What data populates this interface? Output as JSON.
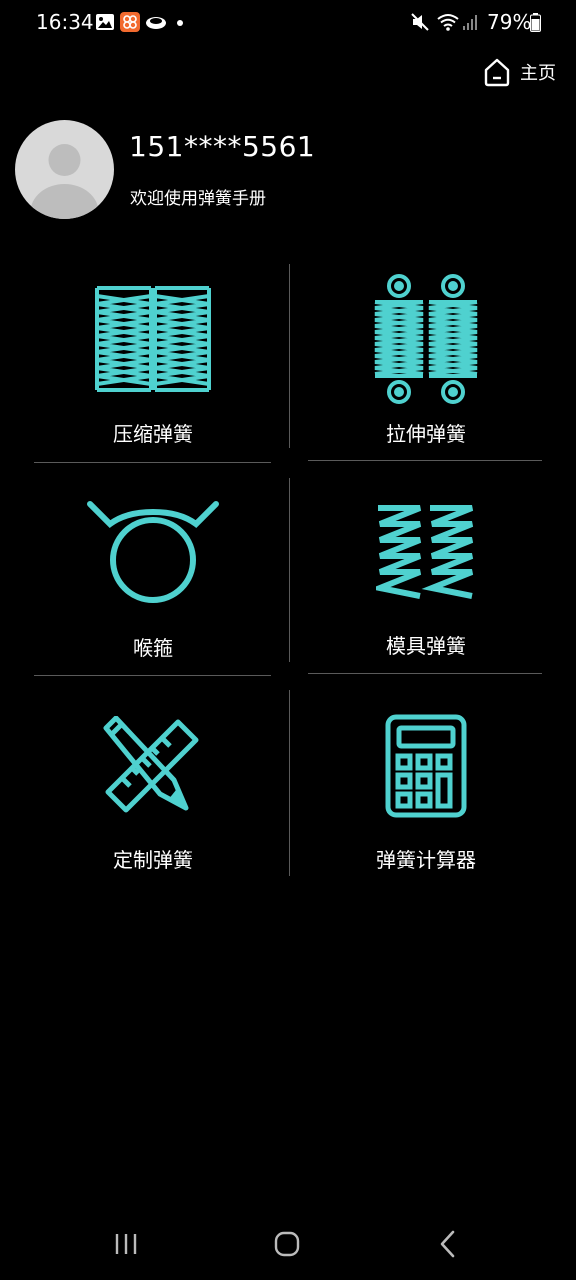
{
  "status_bar": {
    "time": "16:34",
    "battery": "79%",
    "icons": [
      "gallery-icon",
      "app-icon",
      "cloud-icon",
      "mute-icon",
      "wifi-icon",
      "signal-icon",
      "battery-icon"
    ]
  },
  "header": {
    "home_label": "主页",
    "home_icon": "home-icon"
  },
  "profile": {
    "phone": "151****5561",
    "welcome": "欢迎使用弹簧手册",
    "avatar_icon": "avatar-icon"
  },
  "accent_color": "#4fd1cf",
  "menu": {
    "items": [
      {
        "label": "压缩弹簧",
        "icon": "compression-spring-icon"
      },
      {
        "label": "拉伸弹簧",
        "icon": "extension-spring-icon"
      },
      {
        "label": "喉箍",
        "icon": "hose-clamp-icon"
      },
      {
        "label": "模具弹簧",
        "icon": "die-spring-icon"
      },
      {
        "label": "定制弹簧",
        "icon": "custom-design-icon"
      },
      {
        "label": "弹簧计算器",
        "icon": "calculator-icon"
      }
    ]
  },
  "nav_bar": {
    "buttons": [
      "recent-apps-icon",
      "home-button-icon",
      "back-icon"
    ]
  }
}
